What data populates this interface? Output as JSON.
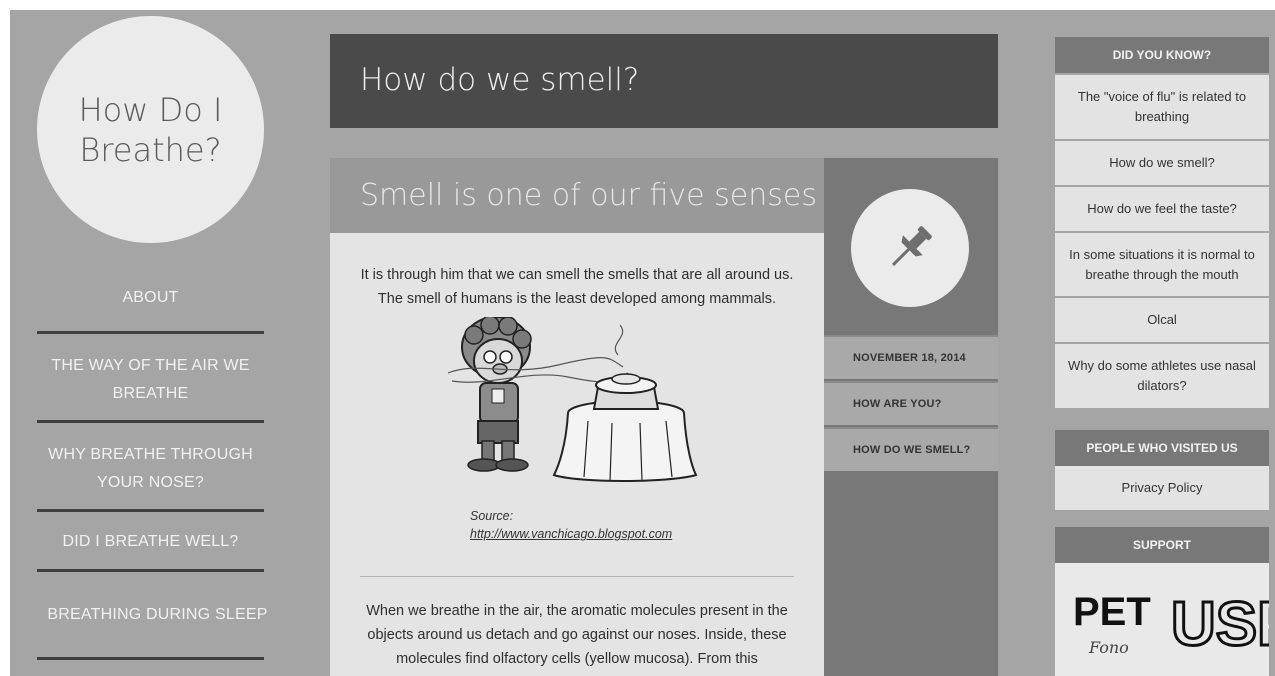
{
  "site": {
    "logo_text": "How Do I Breathe?"
  },
  "nav": {
    "items": [
      {
        "label": "ABOUT"
      },
      {
        "label": "THE WAY OF THE AIR WE BREATHE"
      },
      {
        "label": "WHY BREATHE THROUGH YOUR NOSE?"
      },
      {
        "label": "DID I BREATHE WELL?"
      },
      {
        "label": "BREATHING DURING SLEEP"
      }
    ]
  },
  "page": {
    "title": "How do we smell?"
  },
  "post": {
    "heading": "Smell is one of our five senses",
    "intro": "It is through him that we can smell the smells that are all around us. The smell of humans is the least developed among mammals.",
    "source_label": "Source:",
    "source_link": "http://www.vanchicago.blogspot.com",
    "body": "When we breathe in the air, the aromatic molecules present in the objects around us detach and go against our noses. Inside, these molecules find olfactory cells (yellow mucosa). From this",
    "pin_icon": "pushpin-icon"
  },
  "meta": {
    "date": "NOVEMBER 18, 2014",
    "prev": "HOW ARE YOU?",
    "next": "HOW DO WE SMELL?"
  },
  "widgets": {
    "did_you_know": {
      "title": "DID YOU KNOW?",
      "items": [
        {
          "label": "The \"voice of flu\" is related to breathing"
        },
        {
          "label": "How do we smell?"
        },
        {
          "label": "How do we feel the taste?"
        },
        {
          "label": "In some situations it is normal to breathe through the mouth"
        },
        {
          "label": "Olcal"
        },
        {
          "label": "Why do some athletes use nasal dilators?"
        }
      ]
    },
    "visitors": {
      "title": "PEOPLE WHO VISITED US",
      "items": [
        {
          "label": "Privacy Policy"
        }
      ]
    },
    "support": {
      "title": "SUPPORT",
      "logos": [
        "PET",
        "Fono",
        "USP"
      ]
    }
  },
  "colors": {
    "frame": "#a5a5a5",
    "title_bar": "#4a4a4a",
    "widget_head": "#787878"
  }
}
